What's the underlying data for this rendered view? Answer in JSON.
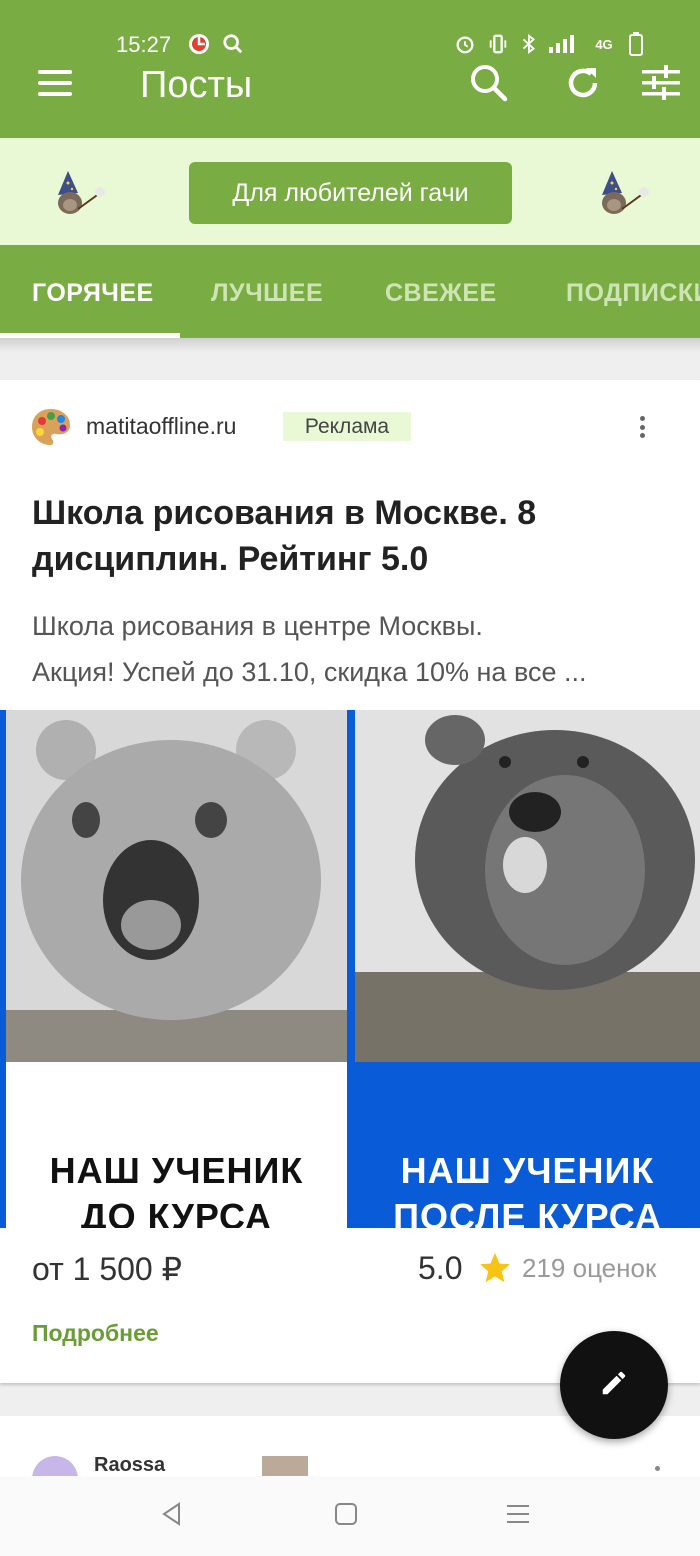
{
  "status_bar": {
    "time": "15:27",
    "network": "4G",
    "icons": [
      "app-notification-icon",
      "search-icon",
      "alarm-icon",
      "vibrate-icon",
      "bluetooth-icon",
      "signal-icon",
      "battery-icon"
    ]
  },
  "toolbar": {
    "title": "Посты",
    "icons": [
      "menu-icon",
      "search-icon",
      "refresh-icon",
      "filter-icon"
    ]
  },
  "banner": {
    "button_label": "Для любителей гачи"
  },
  "tabs": [
    {
      "label": "ГОРЯЧЕЕ",
      "active": true
    },
    {
      "label": "ЛУЧШЕЕ",
      "active": false
    },
    {
      "label": "СВЕЖЕЕ",
      "active": false
    },
    {
      "label": "ПОДПИСКИ",
      "active": false
    }
  ],
  "ad_post": {
    "source": "matitaoffline.ru",
    "badge": "Реклама",
    "title": "Школа рисования в Москве. 8 дисциплин. Рейтинг 5.0",
    "description_line1": "Школа рисования в центре Москвы.",
    "description_line2": "Акция! Успей до 31.10, скидка 10% на все ...",
    "image": {
      "left_caption_1": "НАШ УЧЕНИК",
      "left_caption_2": "ДО КУРСА",
      "right_caption_1": "НАШ УЧЕНИК",
      "right_caption_2": "ПОСЛЕ КУРСА"
    },
    "price": "от 1 500 ₽",
    "rating": "5.0",
    "reviews": "219 оценок",
    "more_link": "Подробнее"
  },
  "next_post": {
    "author": "Raossa"
  },
  "fab": {
    "icon": "pencil-icon"
  },
  "nav_bar": {
    "icons": [
      "back-icon",
      "home-icon",
      "recents-icon"
    ]
  },
  "colors": {
    "brand_green": "#79ad43",
    "banner_bg": "#e9f8d5",
    "link_green": "#6a9d36",
    "ad_blue": "#0a5bd8",
    "star": "#f7c416"
  }
}
